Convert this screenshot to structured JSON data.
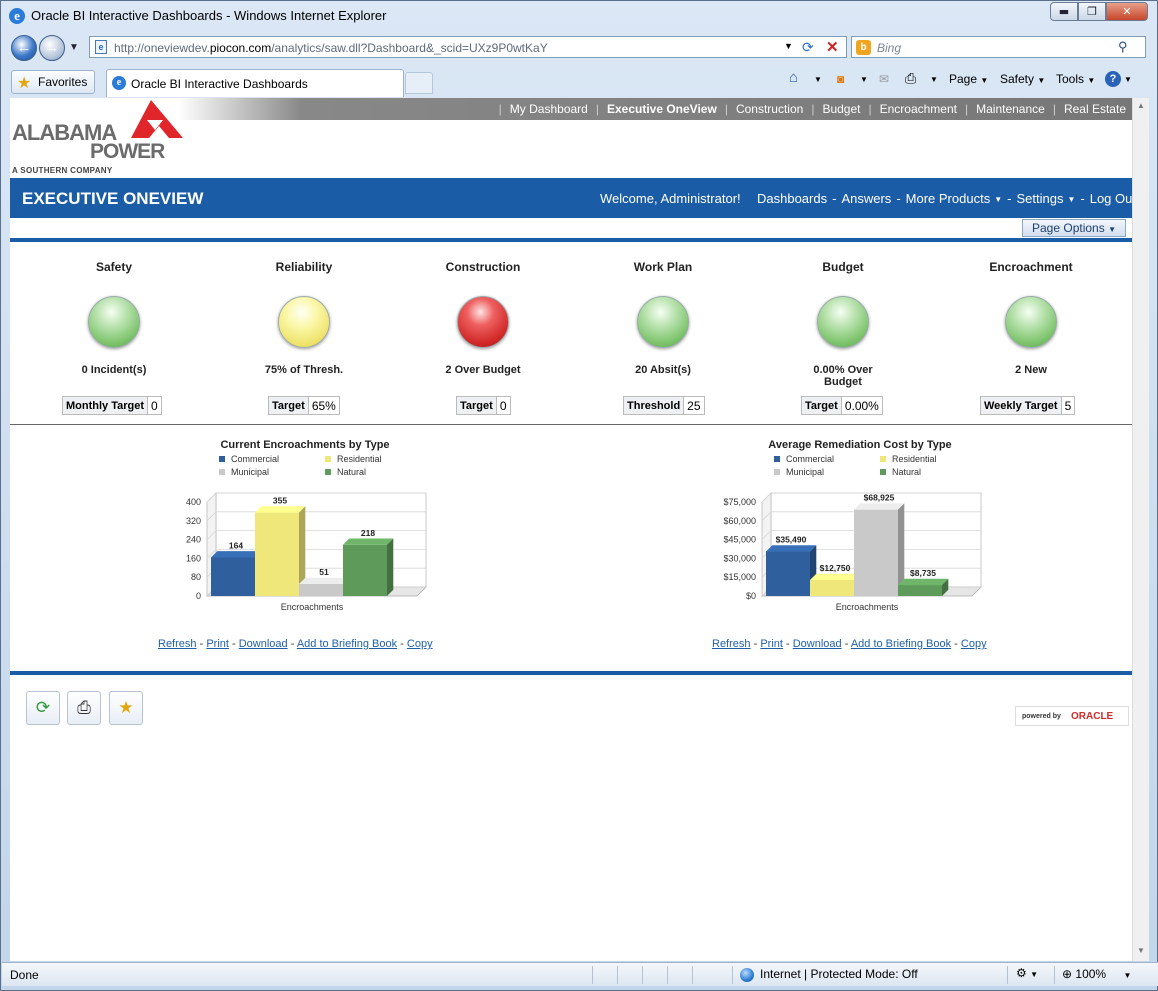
{
  "window": {
    "title": "Oracle BI Interactive Dashboards - Windows Internet Explorer",
    "min_glyph": "▬",
    "max_glyph": "❐",
    "close_glyph": "✕"
  },
  "browser": {
    "url_prefix": "http://oneviewdev.",
    "url_domain": "piocon.com",
    "url_suffix": "/analytics/saw.dll?Dashboard&_scid=UXz9P0wtKaY",
    "search_placeholder": "Bing",
    "favorites_label": "Favorites",
    "tab_label": "Oracle BI Interactive Dashboards",
    "commands": [
      "Page",
      "Safety",
      "Tools"
    ]
  },
  "top_nav": {
    "items": [
      {
        "label": "My Dashboard"
      },
      {
        "label": "Executive OneView"
      },
      {
        "label": "Construction"
      },
      {
        "label": "Budget"
      },
      {
        "label": "Encroachment"
      },
      {
        "label": "Maintenance"
      },
      {
        "label": "Real Estate"
      }
    ]
  },
  "logo": {
    "line1": "ALABAMA",
    "line2": "POWER",
    "line3": "A SOUTHERN COMPANY",
    "accent_color": "#e0262b"
  },
  "header": {
    "title": "EXECUTIVE ONEVIEW",
    "welcome": "Welcome, Administrator!",
    "dashboards": "Dashboards",
    "answers": "Answers",
    "more_products": "More Products",
    "settings": "Settings",
    "logout": "Log Out",
    "page_options": "Page Options"
  },
  "kpis": [
    {
      "name": "Safety",
      "status": "green",
      "value": "0 Incident(s)",
      "target_label": "Monthly Target",
      "target_value": "0"
    },
    {
      "name": "Reliability",
      "status": "yellow",
      "value": "75% of Thresh.",
      "target_label": "Target",
      "target_value": "65%"
    },
    {
      "name": "Construction",
      "status": "red",
      "value": "2 Over Budget",
      "target_label": "Target",
      "target_value": "0"
    },
    {
      "name": "Work Plan",
      "status": "green",
      "value": "20 Absit(s)",
      "target_label": "Threshold",
      "target_value": "25"
    },
    {
      "name": "Budget",
      "status": "green",
      "value": "0.00% Over Budget",
      "target_label": "Target",
      "target_value": "0.00%"
    },
    {
      "name": "Encroachment",
      "status": "green",
      "value": "2 New",
      "target_label": "Weekly Target",
      "target_value": "5"
    }
  ],
  "chart_links": {
    "refresh": "Refresh",
    "print": "Print",
    "download": "Download",
    "briefing": "Add to Briefing Book",
    "copy": "Copy"
  },
  "chart_data": [
    {
      "type": "bar",
      "title": "Current Encroachments by Type",
      "xlabel": "Encroachments",
      "categories": [
        "Encroachments"
      ],
      "series": [
        {
          "name": "Commercial",
          "values": [
            164
          ],
          "color": "#2f5f9c"
        },
        {
          "name": "Residential",
          "values": [
            355
          ],
          "color": "#f0e77a"
        },
        {
          "name": "Municipal",
          "values": [
            51
          ],
          "color": "#c9c9c9"
        },
        {
          "name": "Natural",
          "values": [
            218
          ],
          "color": "#5e9a5a"
        }
      ],
      "data_labels": [
        "164",
        "355",
        "51",
        "218"
      ],
      "yticks": [
        "0",
        "80",
        "160",
        "240",
        "320",
        "400"
      ],
      "ylim": [
        0,
        400
      ],
      "grid": true,
      "legend": "top"
    },
    {
      "type": "bar",
      "title": "Average Remediation Cost by Type",
      "xlabel": "Encroachments",
      "categories": [
        "Encroachments"
      ],
      "series": [
        {
          "name": "Commercial",
          "values": [
            35490
          ],
          "color": "#2f5f9c"
        },
        {
          "name": "Residential",
          "values": [
            12750
          ],
          "color": "#f0e77a"
        },
        {
          "name": "Municipal",
          "values": [
            68925
          ],
          "color": "#c9c9c9"
        },
        {
          "name": "Natural",
          "values": [
            8735
          ],
          "color": "#5e9a5a"
        }
      ],
      "data_labels": [
        "$35,490",
        "$12,750",
        "$68,925",
        "$8,735"
      ],
      "yticks": [
        "$0",
        "$15,000",
        "$30,000",
        "$45,000",
        "$60,000",
        "$75,000"
      ],
      "ylim": [
        0,
        75000
      ],
      "grid": true,
      "legend": "top"
    }
  ],
  "footer": {
    "powered_by": "powered by",
    "oracle": "ORACLE"
  },
  "status_bar": {
    "text": "Done",
    "zone": "Internet | Protected Mode: Off",
    "zoom": "100%"
  }
}
